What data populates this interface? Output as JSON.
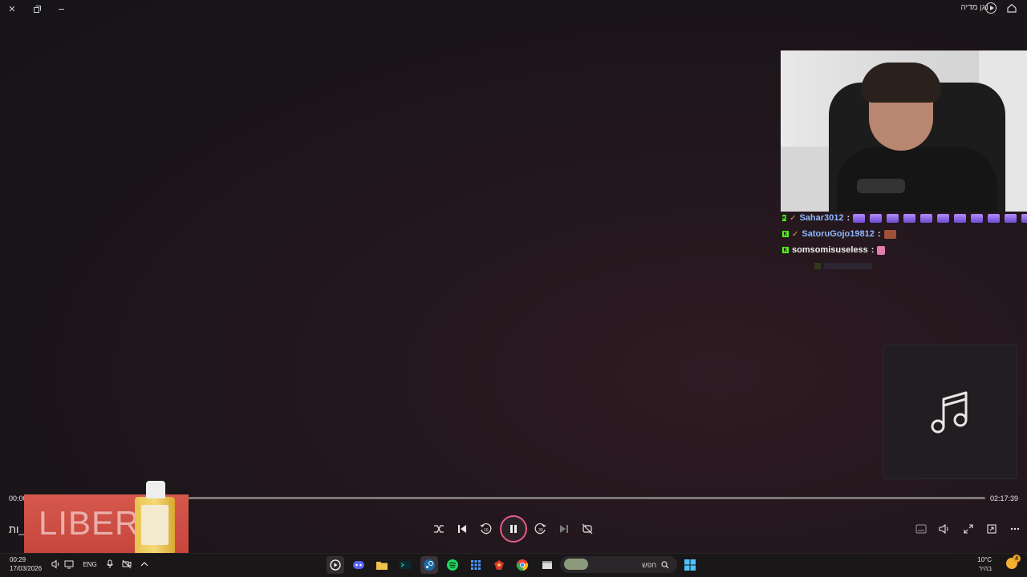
{
  "titlebar": {
    "app_title": "נגן מדיה"
  },
  "chat": {
    "messages": [
      {
        "user": "Sahar3012",
        "sep": ":",
        "emote_count": 12
      },
      {
        "user": "SatoruGojo19812",
        "sep": ":",
        "emote_count": 1
      },
      {
        "user": "somsomisuseless",
        "sep": ":",
        "emote_count": 1
      }
    ]
  },
  "player": {
    "time_elapsed": "00:00",
    "time_total": "02:17:39",
    "progress_fraction": 0.0,
    "song_title": "ות_",
    "ad_text": "LIBERO"
  },
  "taskbar": {
    "time": "00:29",
    "date": "17/03/2026",
    "language": "ENG",
    "search_placeholder": "חפש",
    "weather_temp": "10°C",
    "weather_desc": "בהיר",
    "notification_count": "4"
  },
  "colors": {
    "accent": "#e35b8a",
    "kick_green": "#53fc18"
  }
}
